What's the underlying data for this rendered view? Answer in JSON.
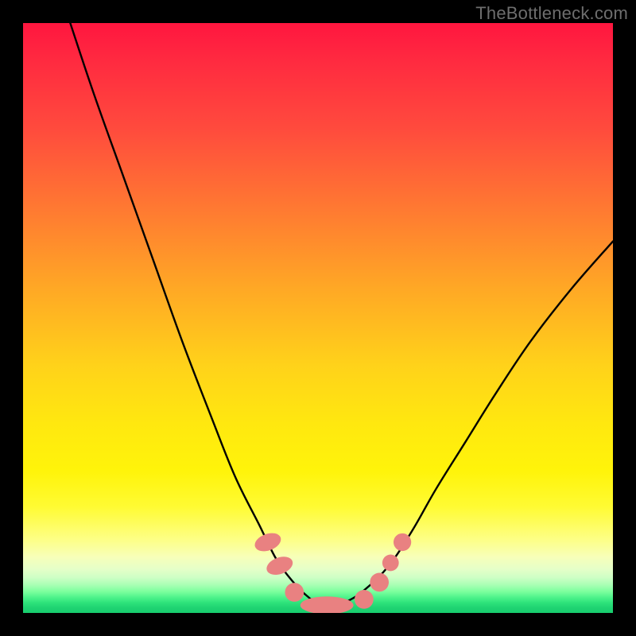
{
  "watermark": "TheBottleneck.com",
  "chart_data": {
    "type": "line",
    "title": "",
    "xlabel": "",
    "ylabel": "",
    "xlim": [
      0,
      100
    ],
    "ylim": [
      0,
      100
    ],
    "grid": false,
    "legend": false,
    "gradient_note": "Background encodes bottleneck severity: red (high) at top to green (none) at bottom.",
    "series": [
      {
        "name": "left-curve",
        "x": [
          8,
          12,
          17,
          22,
          27,
          32,
          36,
          40,
          43,
          46,
          48,
          50,
          52
        ],
        "y": [
          100,
          88,
          74,
          60,
          46,
          33,
          23,
          15,
          9,
          5,
          3,
          1.5,
          1
        ]
      },
      {
        "name": "right-curve",
        "x": [
          52,
          55,
          58,
          62,
          66,
          70,
          75,
          80,
          86,
          93,
          100
        ],
        "y": [
          1,
          2,
          4,
          8,
          14,
          21,
          29,
          37,
          46,
          55,
          63
        ]
      }
    ],
    "markers": [
      {
        "shape": "pill",
        "cx": 41.5,
        "cy": 12.0,
        "rx": 1.4,
        "ry": 2.3,
        "angle": 70
      },
      {
        "shape": "pill",
        "cx": 43.5,
        "cy": 8.0,
        "rx": 1.4,
        "ry": 2.3,
        "angle": 70
      },
      {
        "shape": "round",
        "cx": 46.0,
        "cy": 3.5,
        "r": 1.6
      },
      {
        "shape": "pill",
        "cx": 51.5,
        "cy": 1.3,
        "rx": 4.5,
        "ry": 1.5,
        "angle": 0
      },
      {
        "shape": "round",
        "cx": 57.8,
        "cy": 2.3,
        "r": 1.6
      },
      {
        "shape": "round",
        "cx": 60.4,
        "cy": 5.2,
        "r": 1.6
      },
      {
        "shape": "round",
        "cx": 62.3,
        "cy": 8.5,
        "r": 1.4
      },
      {
        "shape": "round",
        "cx": 64.3,
        "cy": 12.0,
        "r": 1.5
      }
    ],
    "marker_color": "#e98181"
  }
}
